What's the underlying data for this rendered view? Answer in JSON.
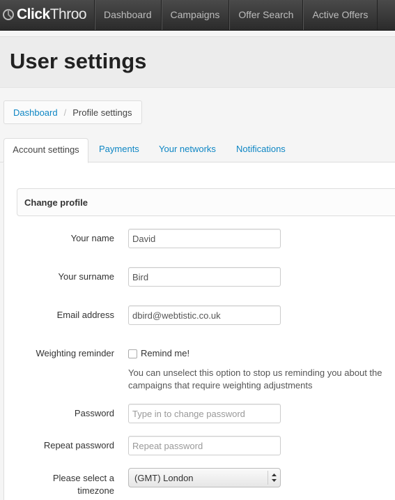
{
  "brand": {
    "name_bold": "Click",
    "name_light": "Throo",
    "icon": "clickthroo-logo-icon"
  },
  "nav": {
    "items": [
      {
        "label": "Dashboard"
      },
      {
        "label": "Campaigns"
      },
      {
        "label": "Offer Search"
      },
      {
        "label": "Active Offers"
      }
    ]
  },
  "page": {
    "title": "User settings"
  },
  "breadcrumb": {
    "home": "Dashboard",
    "separator": "/",
    "current": "Profile settings"
  },
  "tabs": [
    {
      "label": "Account settings",
      "active": true
    },
    {
      "label": "Payments",
      "active": false
    },
    {
      "label": "Your networks",
      "active": false
    },
    {
      "label": "Notifications",
      "active": false
    }
  ],
  "section": {
    "title": "Change profile"
  },
  "form": {
    "name": {
      "label": "Your name",
      "value": "David"
    },
    "surname": {
      "label": "Your surname",
      "value": "Bird"
    },
    "email": {
      "label": "Email address",
      "value": "dbird@webtistic.co.uk"
    },
    "reminder": {
      "label": "Weighting reminder",
      "checkbox_label": "Remind me!",
      "checked": false,
      "help": "You can unselect this option to stop us reminding you about the campaigns that require weighting adjustments"
    },
    "password": {
      "label": "Password",
      "placeholder": "Type in to change password"
    },
    "repeat_password": {
      "label": "Repeat password",
      "placeholder": "Repeat password"
    },
    "timezone": {
      "label_line1": "Please select a",
      "label_line2": "timezone",
      "value": "(GMT) London"
    }
  },
  "colors": {
    "link": "#0e86c4",
    "navbar": "#333333"
  }
}
